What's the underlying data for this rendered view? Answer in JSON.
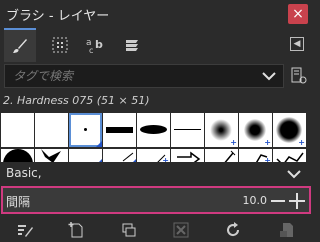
{
  "window": {
    "title": "ブラシ - レイヤー",
    "close_icon": "close-icon",
    "close_glyph": "×"
  },
  "tabs": [
    {
      "name": "brushes-tab",
      "icon": "paintbrush-icon",
      "active": true
    },
    {
      "name": "patterns-tab",
      "icon": "pattern-icon",
      "active": false
    },
    {
      "name": "fonts-tab",
      "icon": "font-icon",
      "active": false
    },
    {
      "name": "document-history-tab",
      "icon": "stack-icon",
      "active": false
    }
  ],
  "tab_menu": {
    "glyph": "◀"
  },
  "search": {
    "placeholder": "タグで検索",
    "value": ""
  },
  "brush": {
    "selected_name": "2. Hardness 075 (51 × 51)"
  },
  "settings": {
    "preset_label": "Basic,"
  },
  "spacing": {
    "label": "間隔",
    "value": "10.0"
  },
  "colors": {
    "highlight": "#cf3a80",
    "accent": "#5b8fd6",
    "close": "#c9424d"
  }
}
